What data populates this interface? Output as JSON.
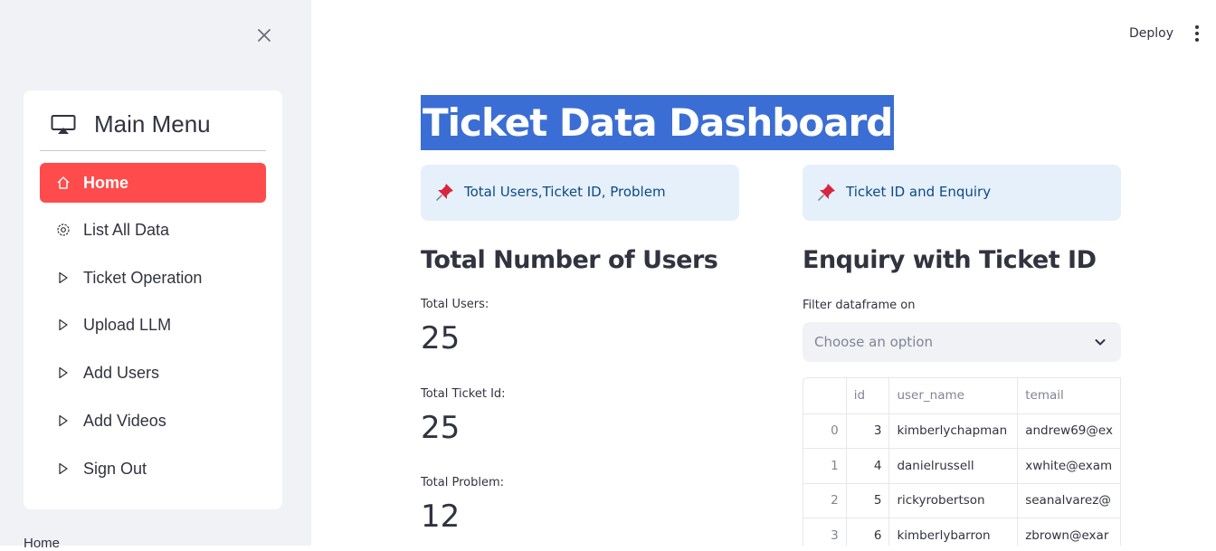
{
  "sidebar": {
    "menu_title": "Main Menu",
    "items": [
      {
        "label": "Home",
        "icon": "house-icon",
        "active": true
      },
      {
        "label": "List All Data",
        "icon": "gear-icon",
        "active": false
      },
      {
        "label": "Ticket Operation",
        "icon": "play-icon",
        "active": false
      },
      {
        "label": "Upload LLM",
        "icon": "play-icon",
        "active": false
      },
      {
        "label": "Add Users",
        "icon": "play-icon",
        "active": false
      },
      {
        "label": "Add Videos",
        "icon": "play-icon",
        "active": false
      },
      {
        "label": "Sign Out",
        "icon": "play-icon",
        "active": false
      }
    ],
    "footer_text": "Home"
  },
  "header": {
    "deploy_label": "Deploy"
  },
  "main": {
    "title": "Ticket Data Dashboard",
    "info_left": "Total Users,Ticket ID, Problem",
    "info_right": "Ticket ID and Enquiry",
    "left_heading": "Total Number of Users",
    "metrics": [
      {
        "label": "Total Users:",
        "value": "25"
      },
      {
        "label": "Total Ticket Id:",
        "value": "25"
      },
      {
        "label": "Total Problem:",
        "value": "12"
      }
    ],
    "right_heading": "Enquiry with Ticket ID",
    "filter_label": "Filter dataframe on",
    "filter_placeholder": "Choose an option",
    "table": {
      "columns": [
        "",
        "id",
        "user_name",
        "temail"
      ],
      "rows": [
        [
          "0",
          "3",
          "kimberlychapman",
          "andrew69@ex"
        ],
        [
          "1",
          "4",
          "danielrussell",
          "xwhite@exam"
        ],
        [
          "2",
          "5",
          "rickyrobertson",
          "seanalvarez@"
        ],
        [
          "3",
          "6",
          "kimberlybarron",
          "zbrown@exar"
        ]
      ]
    }
  },
  "colors": {
    "accent": "#ff4b4b",
    "title_highlight": "#3b6ed4",
    "info_bg": "#e6f0fb",
    "info_text": "#0c4a84",
    "sidebar_bg": "#f0f2f6"
  }
}
